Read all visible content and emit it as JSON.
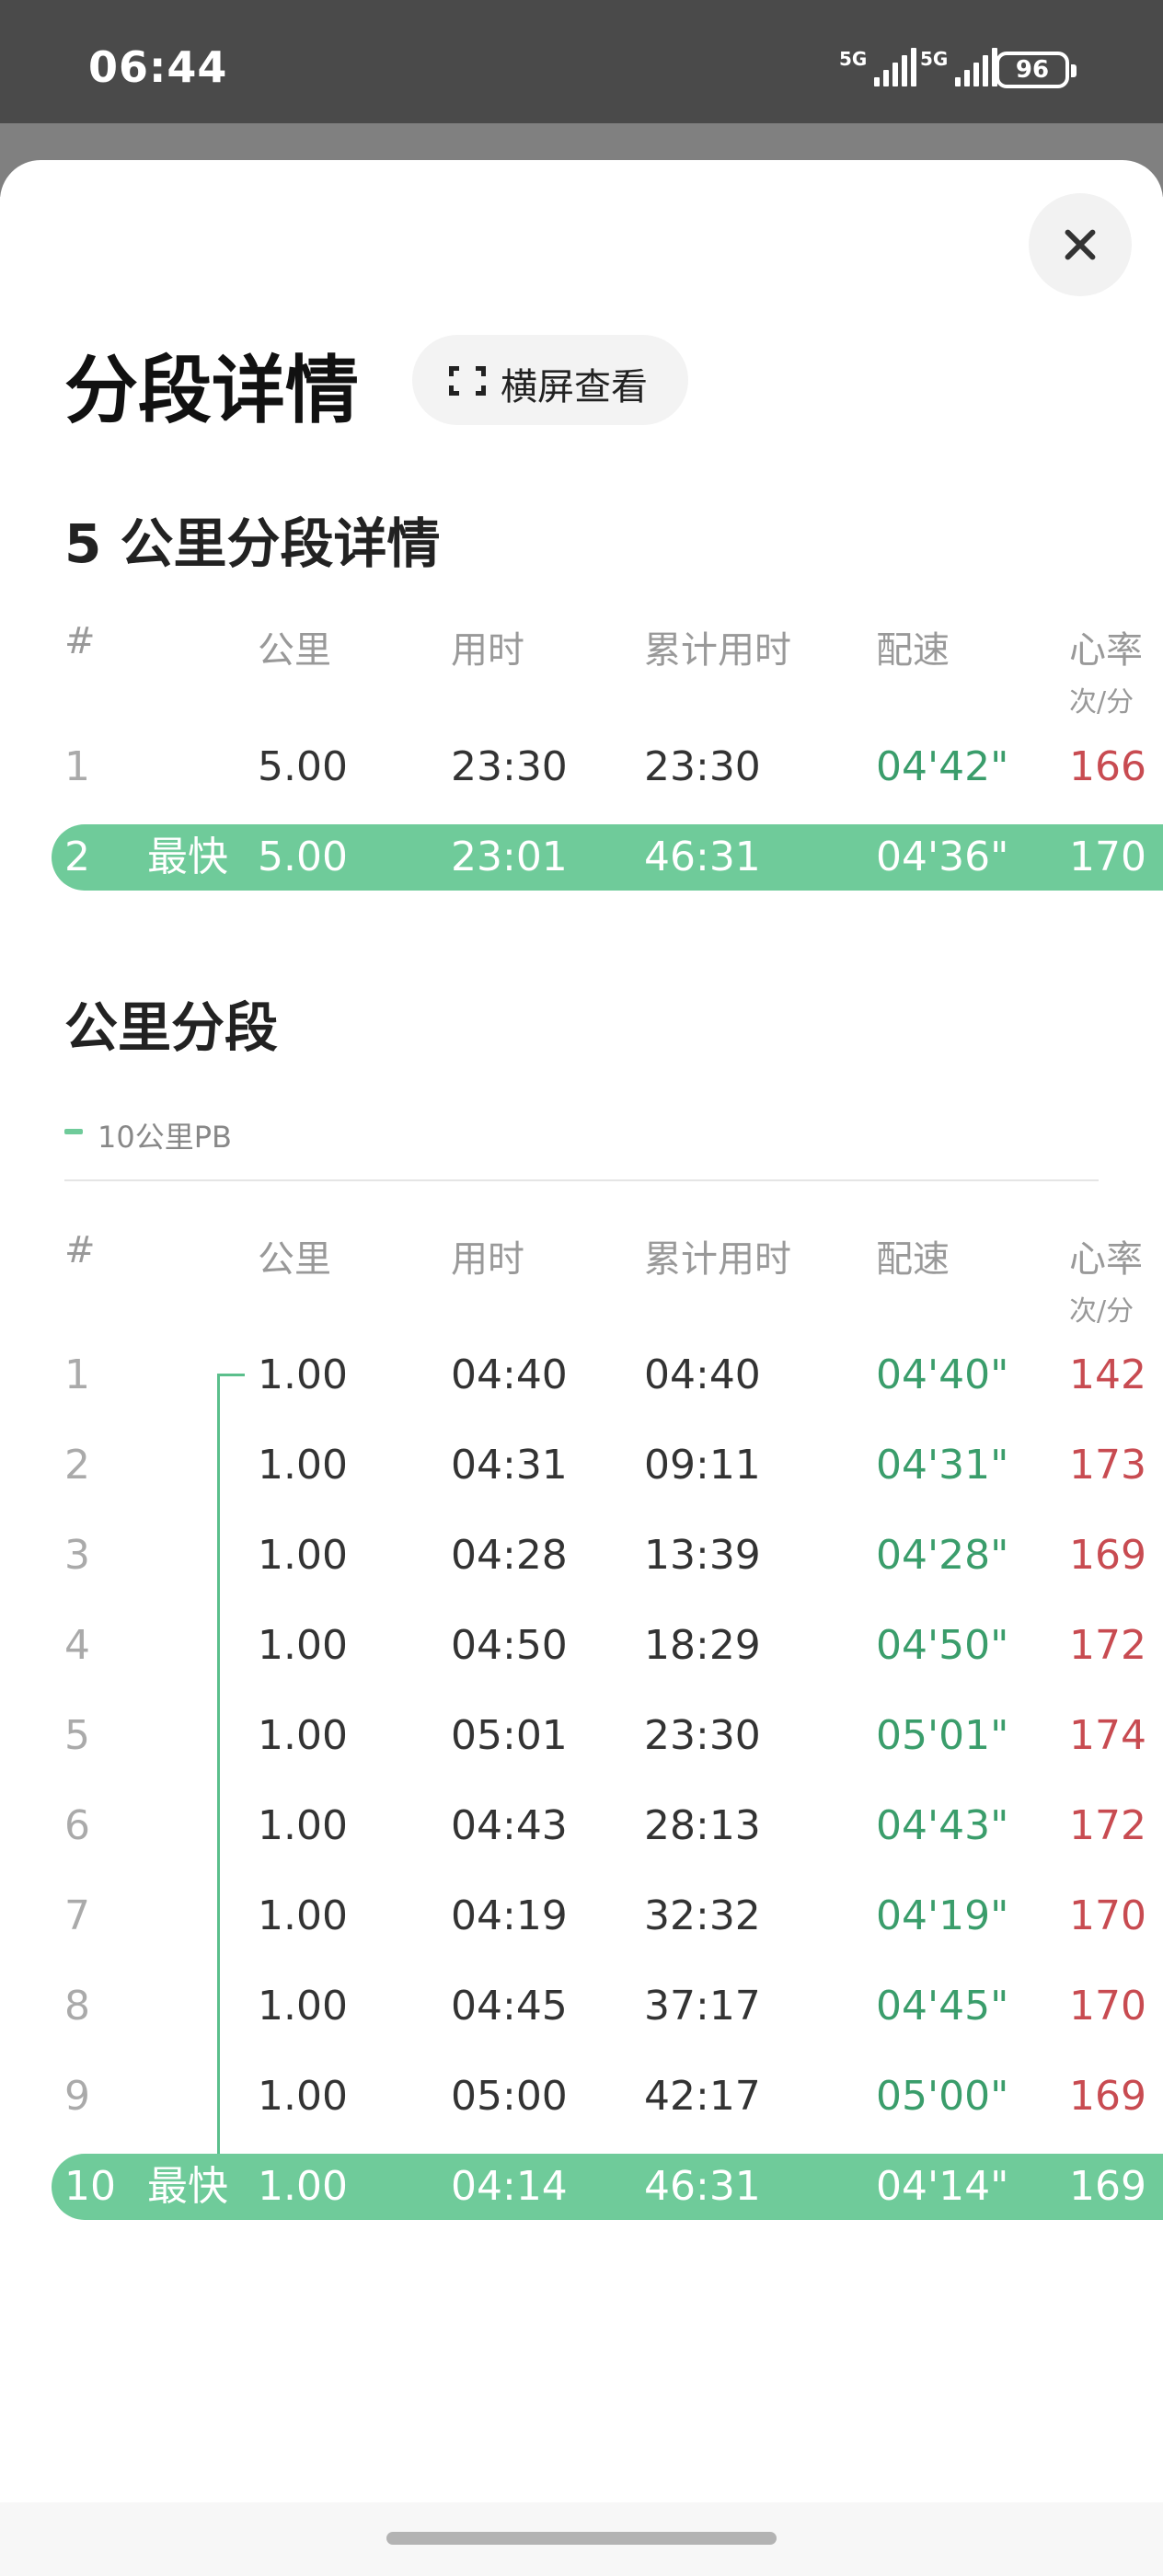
{
  "status_bar": {
    "time": "06:44",
    "network1": "5G",
    "network2": "5G",
    "battery": "96"
  },
  "header": {
    "title": "分段详情",
    "landscape_label": "横屏查看"
  },
  "columns": {
    "index": "#",
    "km": "公里",
    "time": "用时",
    "cumulative": "累计用时",
    "pace": "配速",
    "hr": "心率",
    "hr_unit": "次/分"
  },
  "fastest_label": "最快",
  "five_km": {
    "title": "5 公里分段详情",
    "rows": [
      {
        "index": "1",
        "km": "5.00",
        "time": "23:30",
        "cumulative": "23:30",
        "pace": "04'42\"",
        "hr": "166",
        "best": false
      },
      {
        "index": "2",
        "km": "5.00",
        "time": "23:01",
        "cumulative": "46:31",
        "pace": "04'36\"",
        "hr": "170",
        "best": true
      }
    ]
  },
  "km_splits": {
    "title": "公里分段",
    "legend": "10公里PB",
    "rows": [
      {
        "index": "1",
        "km": "1.00",
        "time": "04:40",
        "cumulative": "04:40",
        "pace": "04'40\"",
        "hr": "142",
        "best": false
      },
      {
        "index": "2",
        "km": "1.00",
        "time": "04:31",
        "cumulative": "09:11",
        "pace": "04'31\"",
        "hr": "173",
        "best": false
      },
      {
        "index": "3",
        "km": "1.00",
        "time": "04:28",
        "cumulative": "13:39",
        "pace": "04'28\"",
        "hr": "169",
        "best": false
      },
      {
        "index": "4",
        "km": "1.00",
        "time": "04:50",
        "cumulative": "18:29",
        "pace": "04'50\"",
        "hr": "172",
        "best": false
      },
      {
        "index": "5",
        "km": "1.00",
        "time": "05:01",
        "cumulative": "23:30",
        "pace": "05'01\"",
        "hr": "174",
        "best": false
      },
      {
        "index": "6",
        "km": "1.00",
        "time": "04:43",
        "cumulative": "28:13",
        "pace": "04'43\"",
        "hr": "172",
        "best": false
      },
      {
        "index": "7",
        "km": "1.00",
        "time": "04:19",
        "cumulative": "32:32",
        "pace": "04'19\"",
        "hr": "170",
        "best": false
      },
      {
        "index": "8",
        "km": "1.00",
        "time": "04:45",
        "cumulative": "37:17",
        "pace": "04'45\"",
        "hr": "170",
        "best": false
      },
      {
        "index": "9",
        "km": "1.00",
        "time": "05:00",
        "cumulative": "42:17",
        "pace": "05'00\"",
        "hr": "169",
        "best": false
      },
      {
        "index": "10",
        "km": "1.00",
        "time": "04:14",
        "cumulative": "46:31",
        "pace": "04'14\"",
        "hr": "169",
        "best": true
      }
    ]
  }
}
